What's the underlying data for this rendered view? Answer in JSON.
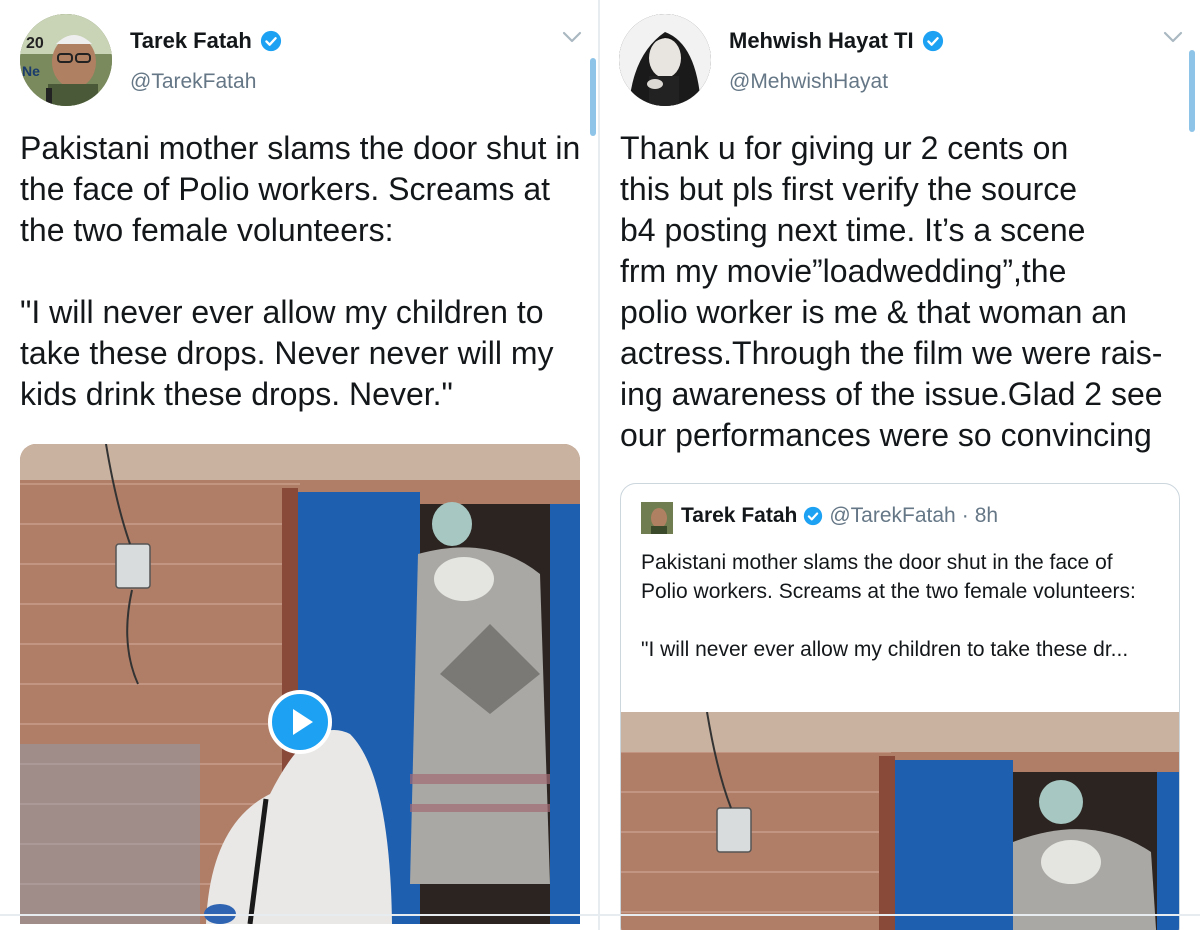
{
  "left_tweet": {
    "display_name": "Tarek Fatah",
    "handle": "@TarekFatah",
    "text": "Pakistani mother slams the door shut in the face of Polio workers. Screams at the two female volunteers:\n\n\"I will never ever allow my children to take these drops. Never never will my kids drink these drops. Never.\"",
    "avatar_text_top": "20",
    "avatar_text_bottom": "Ne"
  },
  "right_tweet": {
    "display_name": "Mehwish Hayat TI",
    "handle": "@MehwishHayat",
    "text": "Thank u for giving ur 2 cents on\nthis but pls first verify the source\nb4 posting next time. It’s a scene\nfrm my movie”loadwedding”,the\npolio worker is me & that woman an\nactress.Through the film we were rais-\ning awareness of the issue.Glad 2 see\nour performances were so convincing"
  },
  "quoted_tweet": {
    "display_name": "Tarek Fatah",
    "handle": "@TarekFatah",
    "separator": "·",
    "time": "8h",
    "text": "Pakistani mother slams the door shut in the face of Polio workers. Screams at the two female volunteers:\n\n\"I will never ever allow my children to take these dr..."
  },
  "colors": {
    "accent": "#1da1f2",
    "text": "#14171a",
    "secondary": "#657786",
    "border": "#e6ecf0",
    "door_blue": "#1f5fb0",
    "brick": "#a9745e"
  },
  "icons": [
    "verified-badge-icon",
    "chevron-down-icon",
    "play-icon"
  ]
}
